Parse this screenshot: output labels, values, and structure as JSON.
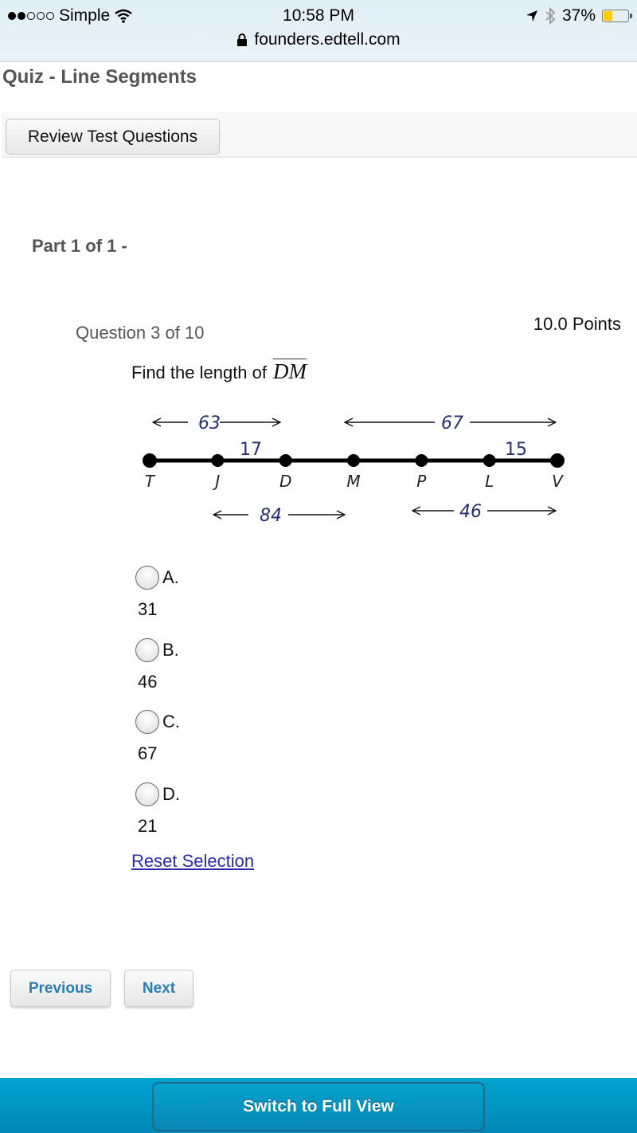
{
  "status_bar": {
    "carrier": "Simple",
    "signal_bars_filled": 2,
    "signal_bars_total": 5,
    "time": "10:58 PM",
    "battery_percent": "37%",
    "battery_level": 0.37,
    "battery_color": "#ffcc00",
    "icons": [
      "wifi-icon",
      "location-arrow-icon",
      "bluetooth-icon",
      "battery-icon",
      "lock-icon"
    ]
  },
  "browser": {
    "url": "founders.edtell.com"
  },
  "page": {
    "title": "Quiz - Line Segments",
    "review_button": "Review Test Questions",
    "part_label": "Part 1 of 1 -"
  },
  "question": {
    "number_label": "Question 3 of 10",
    "points": "10.0 Points",
    "prompt": "Find the length of",
    "segment": "DM",
    "diagram": {
      "points": [
        "T",
        "J",
        "D",
        "M",
        "P",
        "L",
        "V"
      ],
      "labels": {
        "TD": "63",
        "JD": "17",
        "MV": "67",
        "LV": "15",
        "JM": "84",
        "PV": "46"
      }
    }
  },
  "choices": [
    {
      "letter": "A.",
      "value": "31"
    },
    {
      "letter": "B.",
      "value": "46"
    },
    {
      "letter": "C.",
      "value": "67"
    },
    {
      "letter": "D.",
      "value": "21"
    }
  ],
  "reset_label": "Reset Selection",
  "nav": {
    "previous": "Previous",
    "next": "Next",
    "accent_color": "#2a7db3"
  },
  "footer": {
    "full_view": "Switch to Full View",
    "bg_color": "#0095c4"
  }
}
